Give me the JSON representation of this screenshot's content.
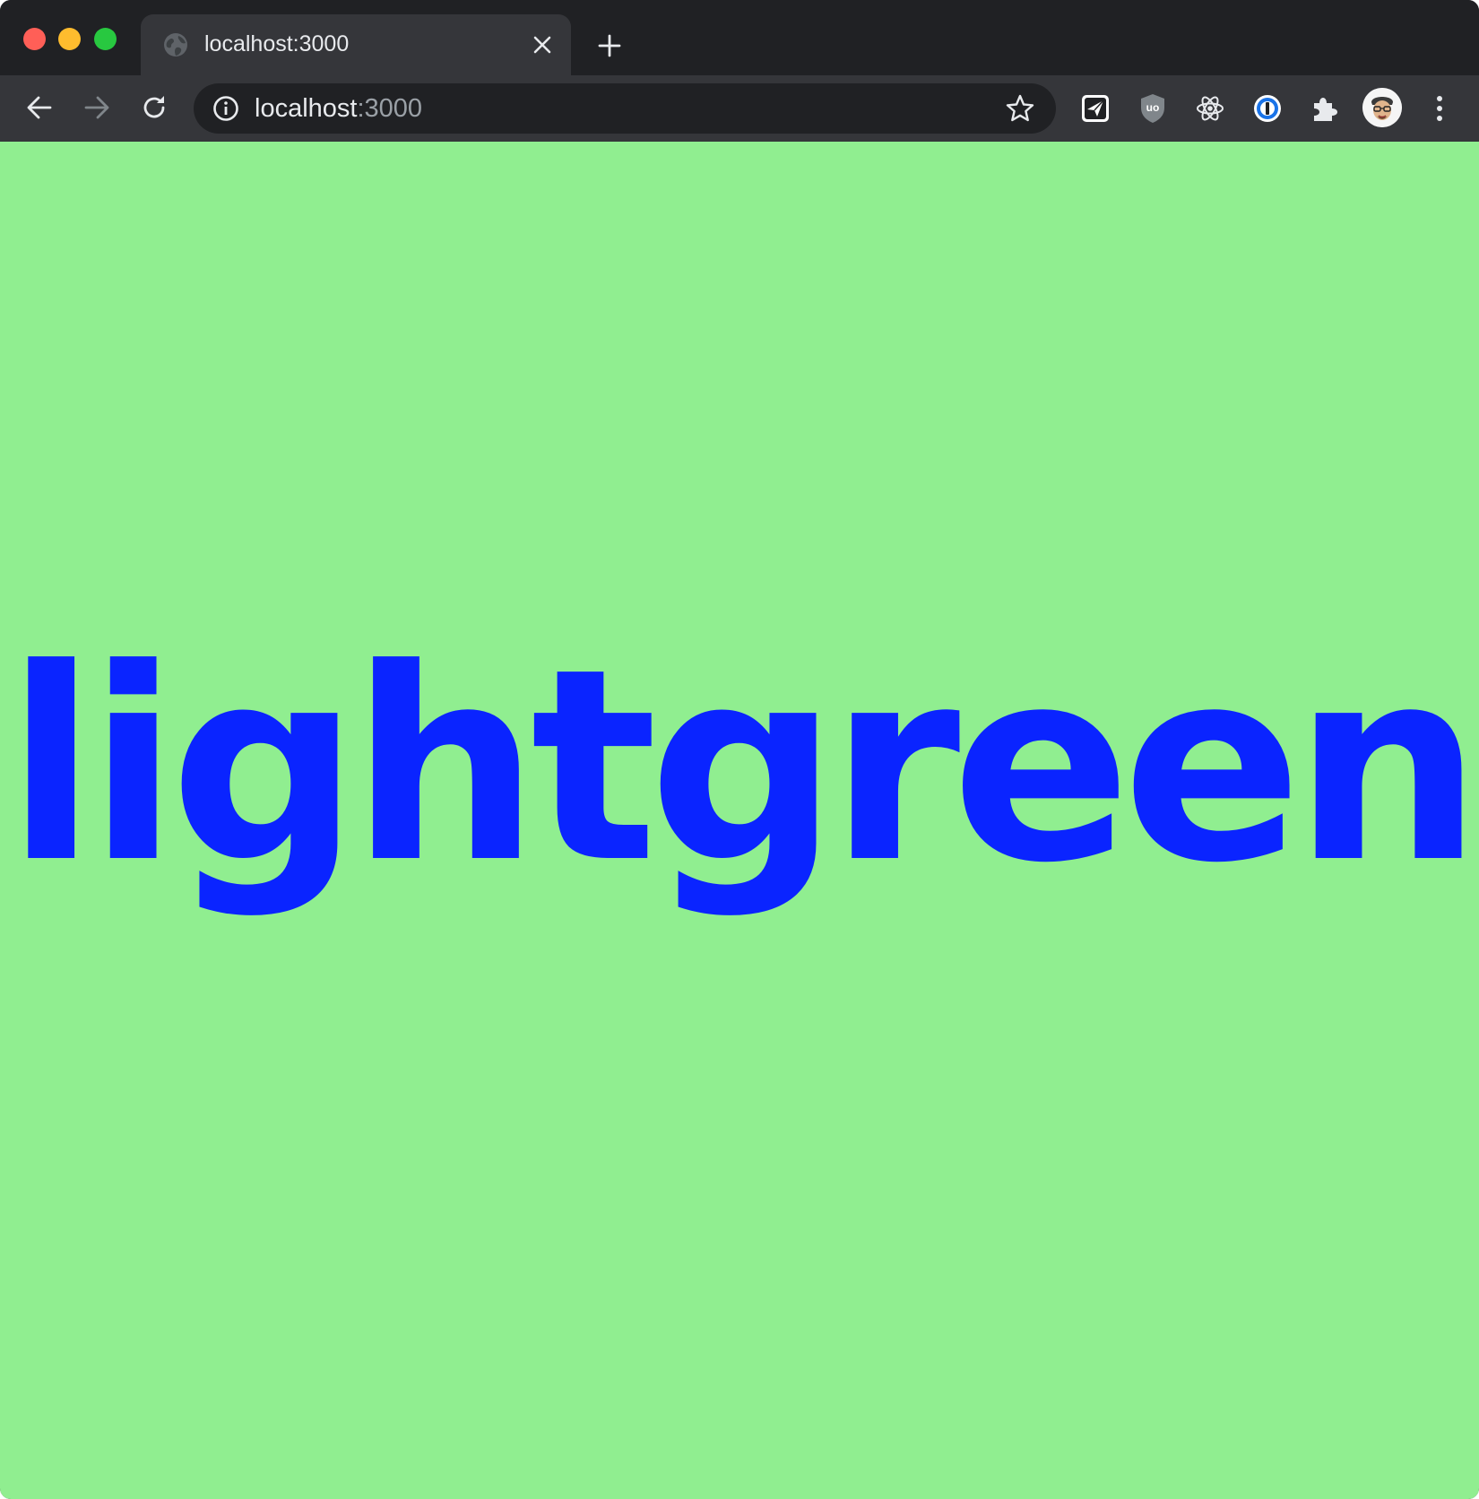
{
  "browser": {
    "tab": {
      "title": "localhost:3000"
    },
    "omnibox": {
      "host": "localhost",
      "port": ":3000"
    },
    "icons": {
      "close": "close-icon",
      "minimize": "minimize-icon",
      "maximize": "maximize-icon",
      "tab_favicon": "globe-icon",
      "tab_close": "close-icon",
      "new_tab": "plus-icon",
      "back": "arrow-left-icon",
      "forward": "arrow-right-icon",
      "reload": "reload-icon",
      "site_info": "info-icon",
      "bookmark": "star-icon",
      "extensions": [
        "send-icon",
        "ublock-icon",
        "react-icon",
        "onepassword-icon",
        "puzzle-icon"
      ],
      "menu": "more-vert-icon"
    },
    "colors": {
      "traffic_close": "#ff5f57",
      "traffic_minimize": "#febc2e",
      "traffic_maximize": "#28c840",
      "titlebar": "#202124",
      "toolbar": "#35363a"
    }
  },
  "page": {
    "headline": "lightgreen",
    "background": "#90ee90",
    "text_color": "#0a24ff"
  }
}
